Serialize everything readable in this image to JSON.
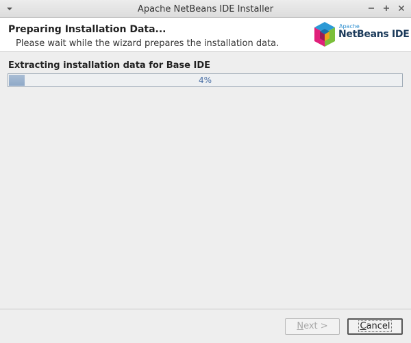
{
  "window": {
    "title": "Apache NetBeans IDE Installer",
    "menu_icon": "chevron-down-icon",
    "controls": [
      "minimize-icon",
      "maximize-icon",
      "close-icon"
    ]
  },
  "header": {
    "title": "Preparing Installation Data...",
    "subtitle": "Please wait while the wizard prepares the installation data.",
    "logo": {
      "line1": "Apache",
      "line2": "NetBeans IDE"
    }
  },
  "main": {
    "status_text": "Extracting installation data for Base IDE",
    "progress": {
      "percent": 4,
      "label": "4%"
    }
  },
  "footer": {
    "next": {
      "mnemonic": "N",
      "rest": "ext >",
      "enabled": false
    },
    "cancel": {
      "mnemonic": "C",
      "rest": "ancel",
      "focused": true
    }
  },
  "colors": {
    "accent": "#8fa9c8",
    "progress_text": "#4a6fa5",
    "logo_text": "#1b3a5a"
  }
}
